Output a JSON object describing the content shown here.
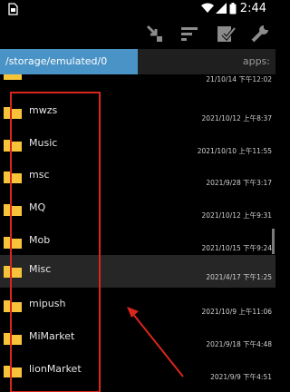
{
  "status": {
    "time": "2:44",
    "icons": [
      "sim-icon",
      "wifi-icon",
      "signal-icon",
      "battery-icon"
    ]
  },
  "toolbar": {
    "icons": [
      "import-icon",
      "sort-icon",
      "select-icon",
      "wrench-icon"
    ]
  },
  "path": {
    "current": "/storage/emulated/0",
    "other": "apps:"
  },
  "files": [
    {
      "name": "",
      "date": "21/10/14 下午12:02"
    },
    {
      "name": "mwzs",
      "date": "2021/10/12 上午8:37"
    },
    {
      "name": "Music",
      "date": "2021/10/10 上午11:55"
    },
    {
      "name": "msc",
      "date": "2021/9/28 下午3:17"
    },
    {
      "name": "MQ",
      "date": "2021/10/12 上午9:31"
    },
    {
      "name": "Mob",
      "date": "2021/10/15 下午9:24"
    },
    {
      "name": "Misc",
      "date": "2021/4/17 下午1:25"
    },
    {
      "name": "mipush",
      "date": "2021/10/9 上午11:06"
    },
    {
      "name": "MiMarket",
      "date": "2021/9/18 下午4:48"
    },
    {
      "name": "lionMarket",
      "date": "2021/9/9 下午4:51"
    }
  ],
  "colors": {
    "accent": "#4a93c6",
    "folder": "#f6c33a",
    "annotation": "#d9261c"
  }
}
